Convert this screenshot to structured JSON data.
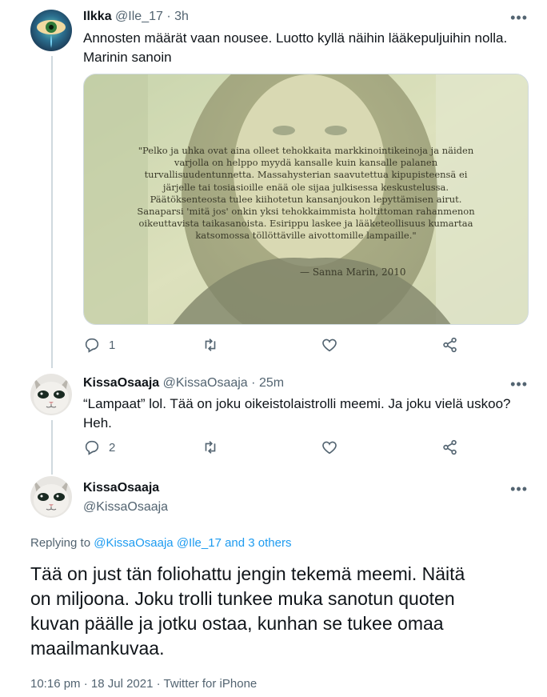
{
  "tweets": [
    {
      "name": "Ilkka",
      "handle": "@Ile_17",
      "time": "3h",
      "text_lines": [
        "Annosten määrät vaan nousee. Luotto kyllä näihin lääkepuljuihin nolla.",
        "Marinin sanoin"
      ],
      "image": {
        "quote_lines": [
          "\"Pelko ja uhka ovat aina olleet tehokkaita markkinointikeinoja ja näiden",
          "varjolla on helppo myydä kansalle kuin kansalle palanen",
          "turvallisuudentunnetta. Massahysterian saavutettua kipupisteensä ei",
          "järjelle tai tosiasioille enää ole sijaa julkisessa keskustelussa.",
          "Päätöksenteosta tulee kiihotetun kansanjoukon lepyttämisen airut.",
          "Sanaparsi 'mitä jos' onkin yksi tehokkaimmista holtittoman rahanmenon",
          "oikeuttavista taikasanoista. Esirippu laskee ja lääketeollisuus kumartaa",
          "katsomossa töllöttäville aivottomille lampaille.\""
        ],
        "author": "— Sanna Marin, 2010"
      },
      "reply_count": "1"
    },
    {
      "name": "KissaOsaaja",
      "handle": "@KissaOsaaja",
      "time": "25m",
      "text_lines": [
        "“Lampaat” lol. Tää on joku oikeistolaistrolli meemi. Ja joku vielä uskoo?",
        "Heh."
      ],
      "reply_count": "2"
    }
  ],
  "main_tweet": {
    "name": "KissaOsaaja",
    "handle": "@KissaOsaaja",
    "replying_prefix": "Replying to",
    "replying_users": "@KissaOsaaja @Ile_17",
    "replying_others": "and 3 others",
    "text_lines": [
      "Tää on just tän foliohattu jengin tekemä meemi. Näitä",
      "on miljoona. Joku trolli tunkee muka sanotun quoten",
      "kuvan päälle ja jotku ostaa, kunhan se tukee omaa",
      "maailmankuvaa."
    ],
    "time": "10:16 pm",
    "date": "18 Jul 2021",
    "source": "Twitter for iPhone"
  },
  "ui": {
    "more": "•••",
    "dot": "·"
  },
  "colors": {
    "accent": "#1d9bf0",
    "secondary": "#536471",
    "text": "#0f1419",
    "thread_line": "#cfd9de"
  },
  "icons": [
    "reply-icon",
    "retweet-icon",
    "like-icon",
    "share-icon",
    "more-icon"
  ]
}
